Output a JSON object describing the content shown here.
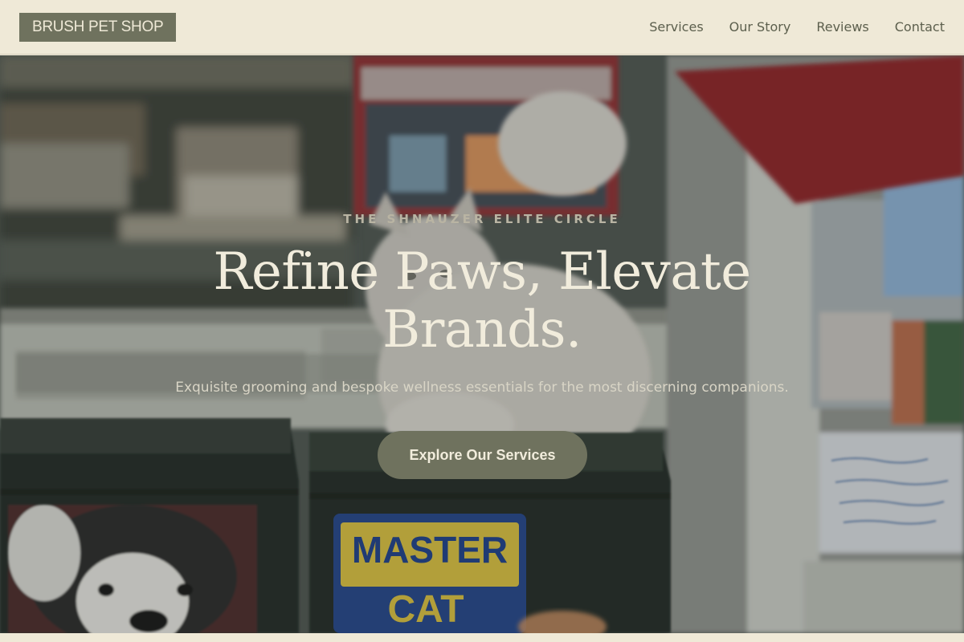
{
  "brand": {
    "name": "BRUSH PET SHOP"
  },
  "nav": {
    "items": [
      "Services",
      "Our Story",
      "Reviews",
      "Contact"
    ]
  },
  "hero": {
    "eyebrow": "THE SHNAUZER ELITE CIRCLE",
    "title": "Refine Paws, Elevate Brands.",
    "subtitle": "Exquisite grooming and bespoke wellness essentials for the most discerning companions.",
    "cta_label": "Explore Our Services",
    "image_text": {
      "bucket_label_top": "MASTER",
      "bucket_label_bottom": "CAT"
    }
  },
  "colors": {
    "background": "#efe9d7",
    "accent": "#6f725e",
    "nav_text": "#5c5f4d",
    "hero_text": "#f1ecdc",
    "eyebrow_text": "#b9b4a3"
  }
}
